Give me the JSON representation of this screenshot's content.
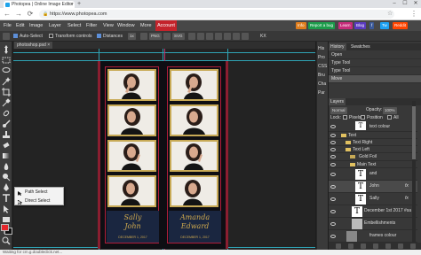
{
  "browser": {
    "tab_title": "Photopea | Online Image Editor",
    "new_tab": "+",
    "url": "https://www.photopea.com",
    "lock": "🔒",
    "back": "←",
    "forward": "→",
    "reload": "⟳",
    "star": "☆",
    "menu": "⋮",
    "minimize": "–",
    "maximize": "☐",
    "close": "✕",
    "tab_close": "×"
  },
  "menubar": {
    "items": [
      "File",
      "Edit",
      "Image",
      "Layer",
      "Select",
      "Filter",
      "View",
      "Window",
      "More",
      "Account"
    ],
    "right_pills": [
      {
        "label": "Info",
        "color": "#e07d1c"
      },
      {
        "label": "Report a bug",
        "color": "#1c9c4b"
      },
      {
        "label": "Learn",
        "color": "#c62c7a"
      },
      {
        "label": "Blog",
        "color": "#5a3ac0"
      },
      {
        "label": "f",
        "color": "#3b5998"
      },
      {
        "label": "Tw",
        "color": "#1da1f2"
      },
      {
        "label": "Reddit",
        "color": "#ff4500"
      }
    ]
  },
  "options": {
    "auto_select": "Auto-Select",
    "transform_controls": "Transform controls",
    "distances": "Distances",
    "zoom": "1x",
    "png": "PNG",
    "svg": "SVG",
    "kx": "KX"
  },
  "document": {
    "tab": "photoshop.psd",
    "tab_close": "×",
    "left_names": [
      "Sally",
      "John"
    ],
    "right_names": [
      "Amanda",
      "Edward"
    ],
    "date_text": "DECEMBER 1, 2017"
  },
  "context_menu": {
    "items": [
      "Path Select",
      "Direct Select"
    ]
  },
  "mini_panel": {
    "items": [
      "His",
      "Pro",
      "CSS",
      "Bru",
      "Cha",
      "Par"
    ]
  },
  "history": {
    "tabs": [
      "History",
      "Swatches"
    ],
    "items": [
      "Open",
      "Type Tool",
      "Type Tool",
      "Move"
    ],
    "selected_index": 3
  },
  "layers": {
    "tab": "Layers",
    "blend_mode": "Normal",
    "opacity_label": "Opacity:",
    "opacity_value": "100%",
    "lock_label": "Lock:",
    "lock_pixels": "Pixels",
    "lock_position": "Position",
    "lock_all": "All",
    "rows": [
      {
        "name": "text colour",
        "type": "text-top",
        "indent": 0
      },
      {
        "name": "Text",
        "type": "folder",
        "indent": 0
      },
      {
        "name": "Text Right",
        "type": "folder",
        "indent": 1
      },
      {
        "name": "Text Left",
        "type": "folder",
        "indent": 1
      },
      {
        "name": "Gold Foil",
        "type": "layer",
        "indent": 2
      },
      {
        "name": "Main Text",
        "type": "folder",
        "indent": 2
      },
      {
        "name": "and",
        "type": "text",
        "indent": 3
      },
      {
        "name": "John",
        "type": "text",
        "indent": 3
      },
      {
        "name": "Sally",
        "type": "text",
        "indent": 3
      },
      {
        "name": "December 1st 2017 #sa",
        "type": "text",
        "indent": 2
      },
      {
        "name": "Embellishments",
        "type": "layer",
        "indent": 2
      },
      {
        "name": "frames colour",
        "type": "layer",
        "indent": 1
      }
    ],
    "fx_label": "fx"
  },
  "status": {
    "text": "Waiting for cm.g.doubleclick.net..."
  },
  "colors": {
    "accent_red": "#c3232b",
    "foreground": "#e5262c",
    "background": "#111111",
    "frame_gold": "#c8aa56",
    "guide_cyan": "#2fa4b5"
  }
}
